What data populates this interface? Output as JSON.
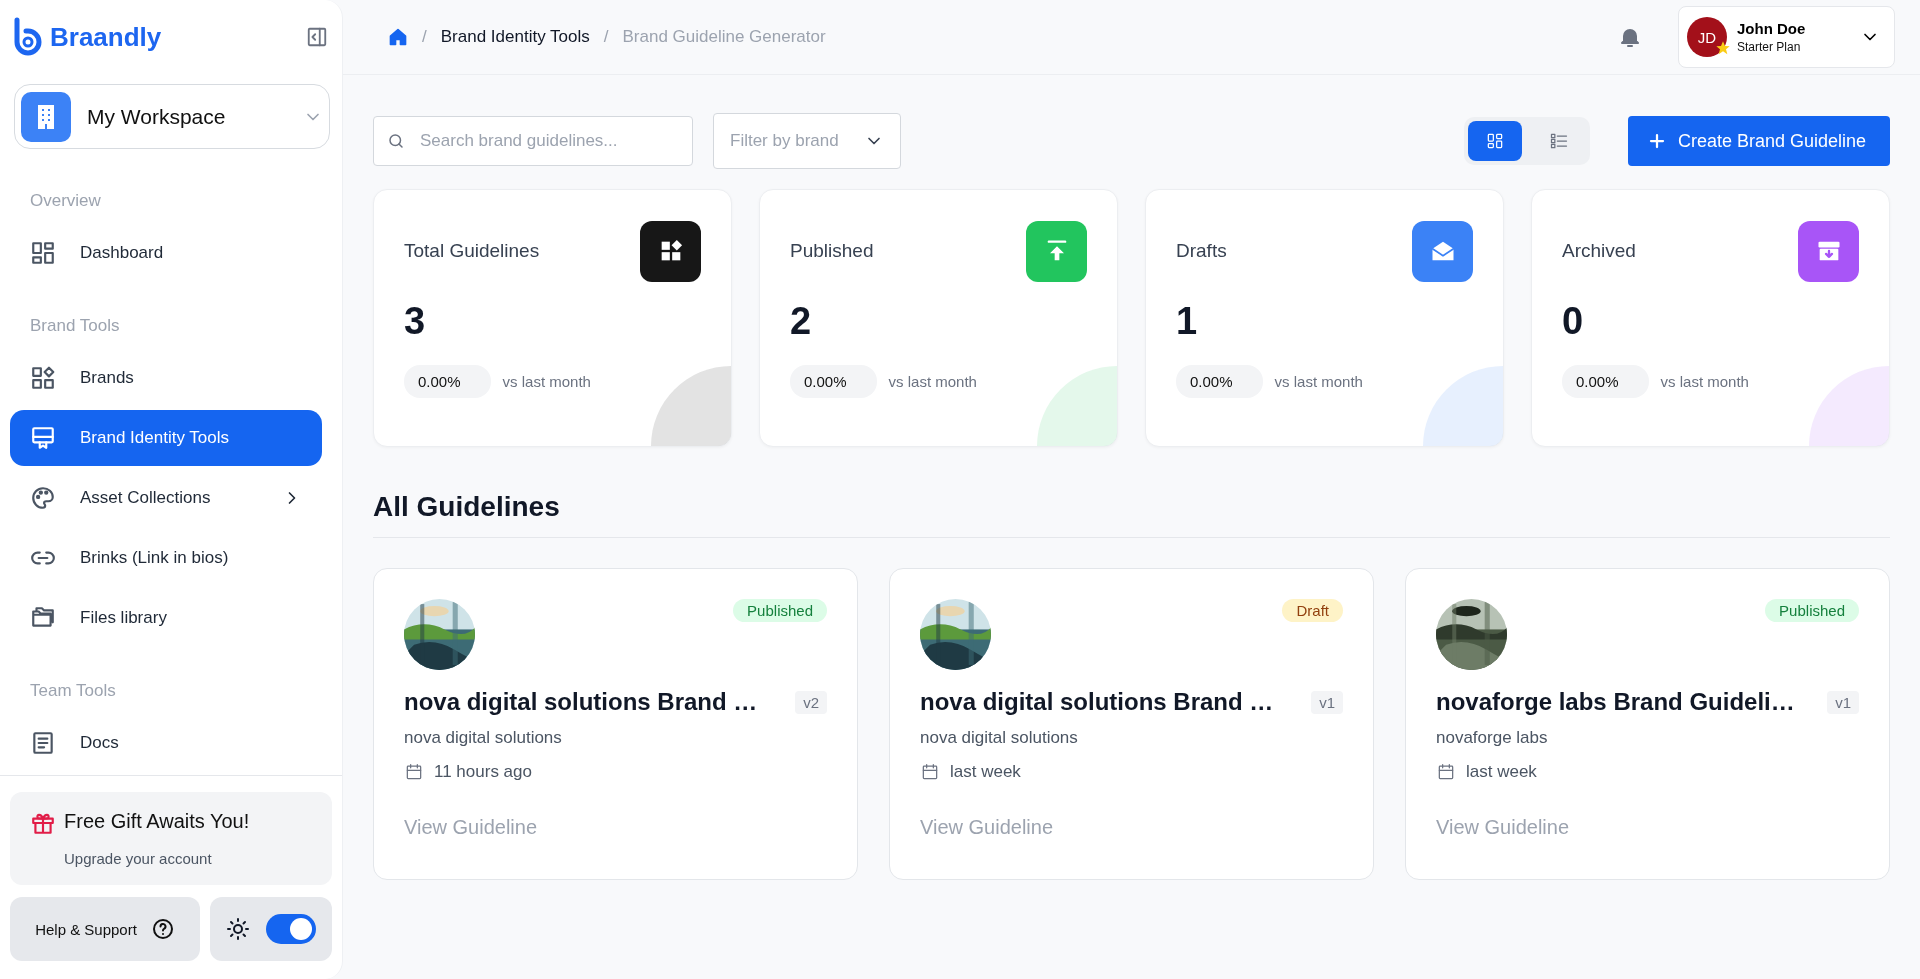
{
  "sidebar": {
    "logo": "Braandly",
    "workspace": {
      "name": "My Workspace"
    },
    "sections": [
      {
        "title": "Overview",
        "items": [
          {
            "label": "Dashboard",
            "kind": "dashboard",
            "selected": false,
            "has_submenu": false
          }
        ]
      },
      {
        "title": "Brand Tools",
        "items": [
          {
            "label": "Brands",
            "kind": "brands",
            "selected": false,
            "has_submenu": false
          },
          {
            "label": "Brand Identity Tools",
            "kind": "identity",
            "selected": true,
            "has_submenu": false
          },
          {
            "label": "Asset Collections",
            "kind": "palette",
            "selected": false,
            "has_submenu": true
          },
          {
            "label": "Brinks (Link in bios)",
            "kind": "link",
            "selected": false,
            "has_submenu": false
          },
          {
            "label": "Files library",
            "kind": "folder",
            "selected": false,
            "has_submenu": false
          }
        ]
      },
      {
        "title": "Team Tools",
        "items": [
          {
            "label": "Docs",
            "kind": "docs",
            "selected": false,
            "has_submenu": false
          }
        ]
      }
    ],
    "promo": {
      "title": "Free Gift Awaits You!",
      "subtitle": "Upgrade your account"
    },
    "help": "Help & Support",
    "theme_toggle": {
      "on": true
    }
  },
  "header": {
    "breadcrumb_separator": "/",
    "breadcrumb": [
      "Brand Identity Tools",
      "Brand Guideline Generator"
    ],
    "user": {
      "initials": "JD",
      "name": "John Doe",
      "plan": "Starter Plan"
    }
  },
  "toolbar": {
    "search": {
      "placeholder": "Search brand guidelines..."
    },
    "filter": "Filter by brand",
    "views": [
      {
        "kind": "grid",
        "selected": true
      },
      {
        "kind": "list",
        "selected": false
      }
    ],
    "create_button": "Create Brand Guideline"
  },
  "stats": [
    {
      "title": "Total Guidelines",
      "value": "3",
      "change": "0.00%",
      "note": "vs last month",
      "kind": "total",
      "color": "#171717"
    },
    {
      "title": "Published",
      "value": "2",
      "change": "0.00%",
      "note": "vs last month",
      "kind": "published",
      "color": "#22c55e"
    },
    {
      "title": "Drafts",
      "value": "1",
      "change": "0.00%",
      "note": "vs last month",
      "kind": "drafts",
      "color": "#3b82f6"
    },
    {
      "title": "Archived",
      "value": "0",
      "change": "0.00%",
      "note": "vs last month",
      "kind": "archived",
      "color": "#a855f7"
    }
  ],
  "section_title": "All Guidelines",
  "guidelines": [
    {
      "status": "Published",
      "kind": "published",
      "version": "v2",
      "title": "nova digital solutions Brand …",
      "brand": "nova digital solutions",
      "time": "11 hours ago",
      "action": "View Guideline"
    },
    {
      "status": "Draft",
      "kind": "draft",
      "version": "v1",
      "title": "nova digital solutions Brand …",
      "brand": "nova digital solutions",
      "time": "last week",
      "action": "View Guideline"
    },
    {
      "status": "Published",
      "kind": "published",
      "version": "v1",
      "title": "novaforge labs Brand Guideli…",
      "brand": "novaforge labs",
      "time": "last week",
      "action": "View Guideline"
    }
  ]
}
